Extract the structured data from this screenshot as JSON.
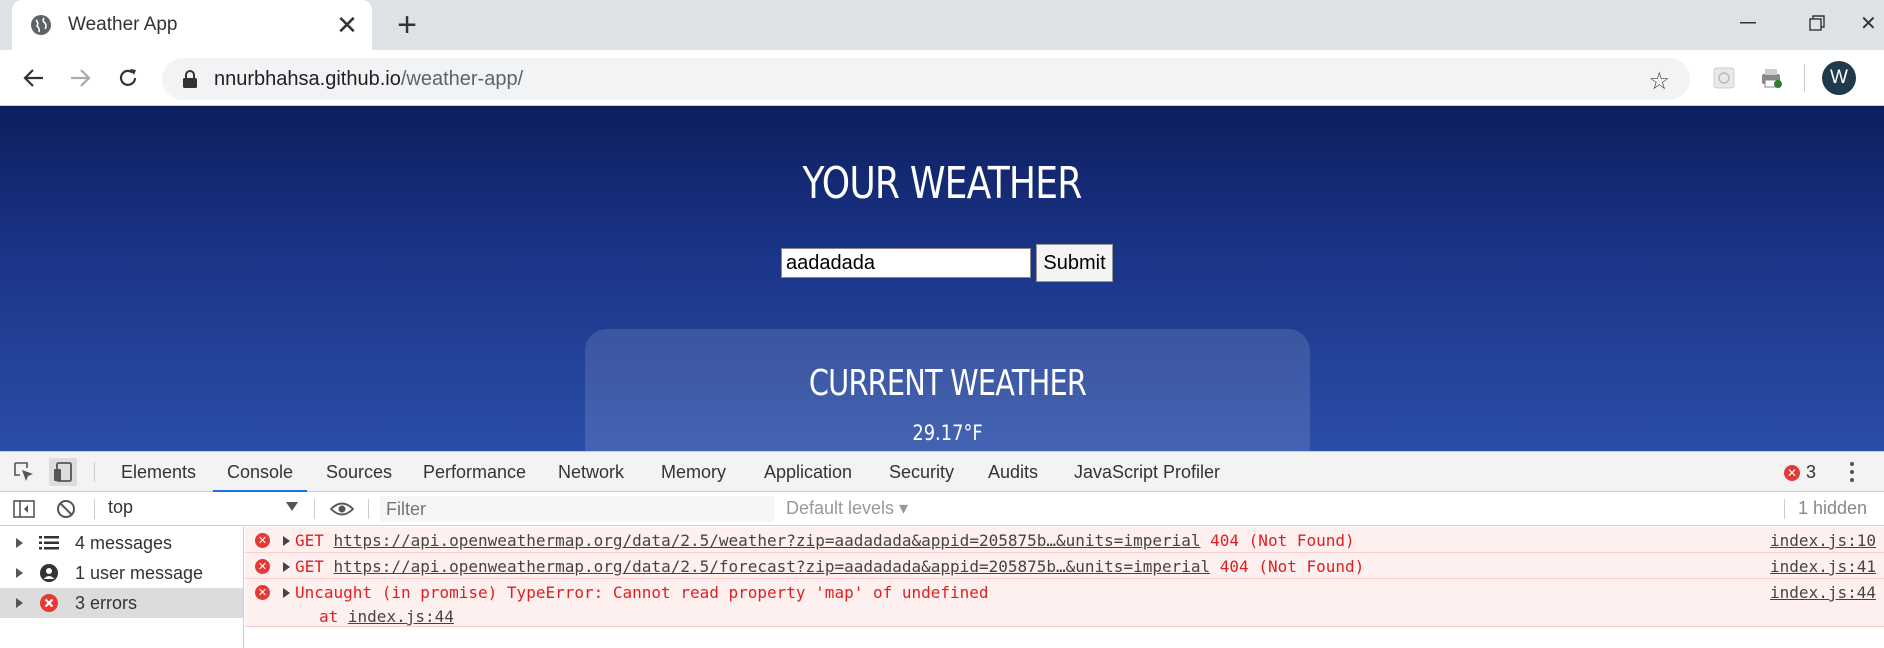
{
  "browser": {
    "tab_title": "Weather App",
    "url_host": "nnurbhahsa.github.io",
    "url_path": "/weather-app/",
    "profile_initial": "W"
  },
  "page": {
    "title": "YOUR WEATHER",
    "zip_value": "aadadada",
    "submit_label": "Submit",
    "card_title": "CURRENT WEATHER",
    "card_temp": "29.17°F"
  },
  "devtools": {
    "tabs": [
      "Elements",
      "Console",
      "Sources",
      "Performance",
      "Network",
      "Memory",
      "Application",
      "Security",
      "Audits",
      "JavaScript Profiler"
    ],
    "active_tab": "Console",
    "error_badge": "3",
    "context": "top",
    "filter_placeholder": "Filter",
    "levels": "Default levels ▾",
    "hidden": "1 hidden",
    "sidebar": [
      {
        "label": "4 messages",
        "icon": "list-icon"
      },
      {
        "label": "1 user message",
        "icon": "user-icon"
      },
      {
        "label": "3 errors",
        "icon": "error-icon"
      }
    ],
    "messages": [
      {
        "method": "GET",
        "url": "https://api.openweathermap.org/data/2.5/weather?zip=aadadada&appid=205875b…&units=imperial",
        "status": "404 (Not Found)",
        "source": "index.js:10"
      },
      {
        "method": "GET",
        "url": "https://api.openweathermap.org/data/2.5/forecast?zip=aadadada&appid=205875b…&units=imperial",
        "status": "404 (Not Found)",
        "source": "index.js:41"
      },
      {
        "text": "Uncaught (in promise) TypeError: Cannot read property 'map' of undefined",
        "stack_prefix": "at ",
        "stack_link": "index.js:44",
        "source": "index.js:44"
      }
    ]
  },
  "colors": {
    "page_gradient_top": "#0d1e5e",
    "page_gradient_bottom": "#2a4ea8",
    "error_red": "#e02020",
    "error_bg": "#fff0f0",
    "devtools_accent": "#1a73e8"
  }
}
